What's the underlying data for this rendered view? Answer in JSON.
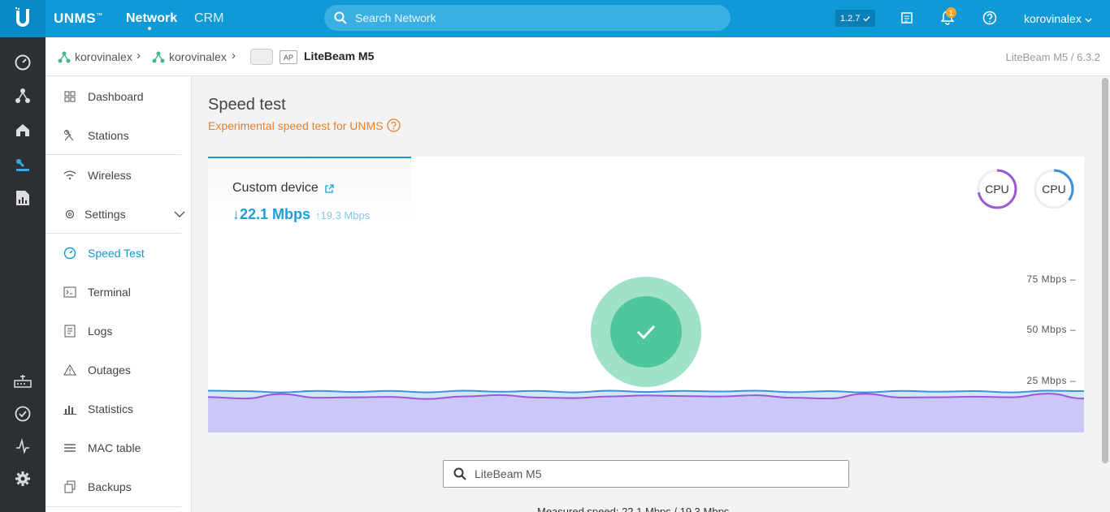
{
  "topbar": {
    "brand": "UNMS",
    "nav_network": "Network",
    "nav_crm": "CRM",
    "search_placeholder": "Search Network",
    "version": "1.2.7",
    "notification_count": "1",
    "user": "korovinalex"
  },
  "breadcrumb": {
    "site1": "korovinalex",
    "site2": "korovinalex",
    "ap_tag": "AP",
    "device": "LiteBeam M5",
    "right_info": "LiteBeam M5 / 6.3.2"
  },
  "menu": {
    "dashboard": "Dashboard",
    "stations": "Stations",
    "wireless": "Wireless",
    "settings": "Settings",
    "speed_test": "Speed Test",
    "terminal": "Terminal",
    "logs": "Logs",
    "outages": "Outages",
    "statistics": "Statistics",
    "mac_table": "MAC table",
    "backups": "Backups"
  },
  "page": {
    "title": "Speed test",
    "subtitle": "Experimental speed test for UNMS"
  },
  "speedtest": {
    "tab_title": "Custom device",
    "download": "↓22.1 Mbps",
    "upload": "↑19.3 Mbps",
    "cpu1_label": "CPU",
    "cpu2_label": "CPU",
    "cpu1_value": 0.72,
    "cpu2_value": 0.35,
    "cpu1_color": "#9b59d6",
    "cpu2_color": "#3a8fe0",
    "device_search_value": "LiteBeam M5",
    "bottom_text": "Measured speed: 22.1 Mbps / 19.3 Mbps"
  },
  "chart_data": {
    "type": "area",
    "y_tick_labels": [
      "75 Mbps –",
      "50 Mbps –",
      "25 Mbps –"
    ],
    "y_ticks": [
      75,
      50,
      25
    ],
    "ylim": [
      0,
      100
    ],
    "series": [
      {
        "color": "#3a8fe0",
        "values": [
          22.4,
          22.2,
          21.6,
          22.3,
          21.8,
          22.3,
          21.6,
          22.4,
          21.9,
          22.3,
          21.6,
          22.4,
          21.8,
          22.3,
          22.0,
          22.4,
          21.7,
          22.2,
          21.6,
          22.3,
          21.9,
          22.2,
          21.6,
          22.4,
          22.2
        ]
      },
      {
        "color": "#9b59d6",
        "values": [
          19.3,
          18.6,
          20.8,
          19.0,
          19.2,
          19.4,
          18.4,
          19.6,
          20.3,
          19.1,
          18.8,
          19.6,
          20.1,
          19.8,
          19.6,
          20.2,
          19.0,
          18.6,
          20.9,
          19.1,
          19.2,
          19.5,
          19.2,
          21.0,
          18.6
        ]
      }
    ]
  }
}
